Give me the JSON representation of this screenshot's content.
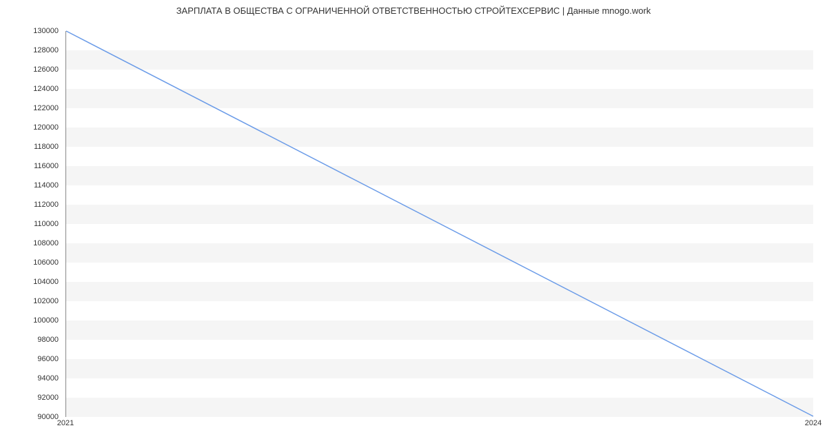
{
  "chart_data": {
    "type": "line",
    "title": "ЗАРПЛАТА В  ОБЩЕСТВА С ОГРАНИЧЕННОЙ ОТВЕТСТВЕННОСТЬЮ СТРОЙТЕХСЕРВИС | Данные mnogo.work",
    "x": [
      2021,
      2024
    ],
    "values": [
      130000,
      90000
    ],
    "xlabel": "",
    "ylabel": "",
    "x_ticks": [
      2021,
      2024
    ],
    "y_ticks": [
      90000,
      92000,
      94000,
      96000,
      98000,
      100000,
      102000,
      104000,
      106000,
      108000,
      110000,
      112000,
      114000,
      116000,
      118000,
      120000,
      122000,
      124000,
      126000,
      128000,
      130000
    ],
    "ylim": [
      90000,
      130000
    ],
    "xlim": [
      2021,
      2024
    ],
    "line_color": "#6a9be8",
    "grid_on": true
  }
}
